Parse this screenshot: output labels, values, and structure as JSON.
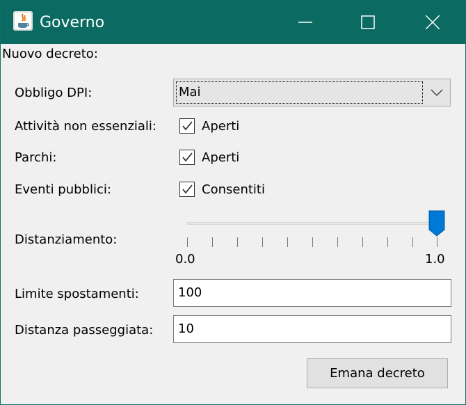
{
  "window": {
    "title": "Governo",
    "controls": {
      "minimize": "minimize-icon",
      "maximize": "maximize-icon",
      "close": "close-icon"
    }
  },
  "form": {
    "heading": "Nuovo decreto:",
    "obbligo_dpi": {
      "label": "Obbligo DPI:",
      "selected": "Mai"
    },
    "attivita": {
      "label": "Attività non essenziali:",
      "checkbox_label": "Aperti",
      "checked": true
    },
    "parchi": {
      "label": "Parchi:",
      "checkbox_label": "Aperti",
      "checked": true
    },
    "eventi": {
      "label": "Eventi pubblici:",
      "checkbox_label": "Consentiti",
      "checked": true
    },
    "distanziamento": {
      "label": "Distanziamento:",
      "min_label": "0.0",
      "max_label": "1.0",
      "value": 1.0
    },
    "limite": {
      "label": "Limite spostamenti:",
      "value": "100"
    },
    "distanza": {
      "label": "Distanza passeggiata:",
      "value": "10"
    },
    "submit_label": "Emana decreto"
  },
  "colors": {
    "titlebar": "#0b6b63",
    "accent": "#0078d7"
  }
}
